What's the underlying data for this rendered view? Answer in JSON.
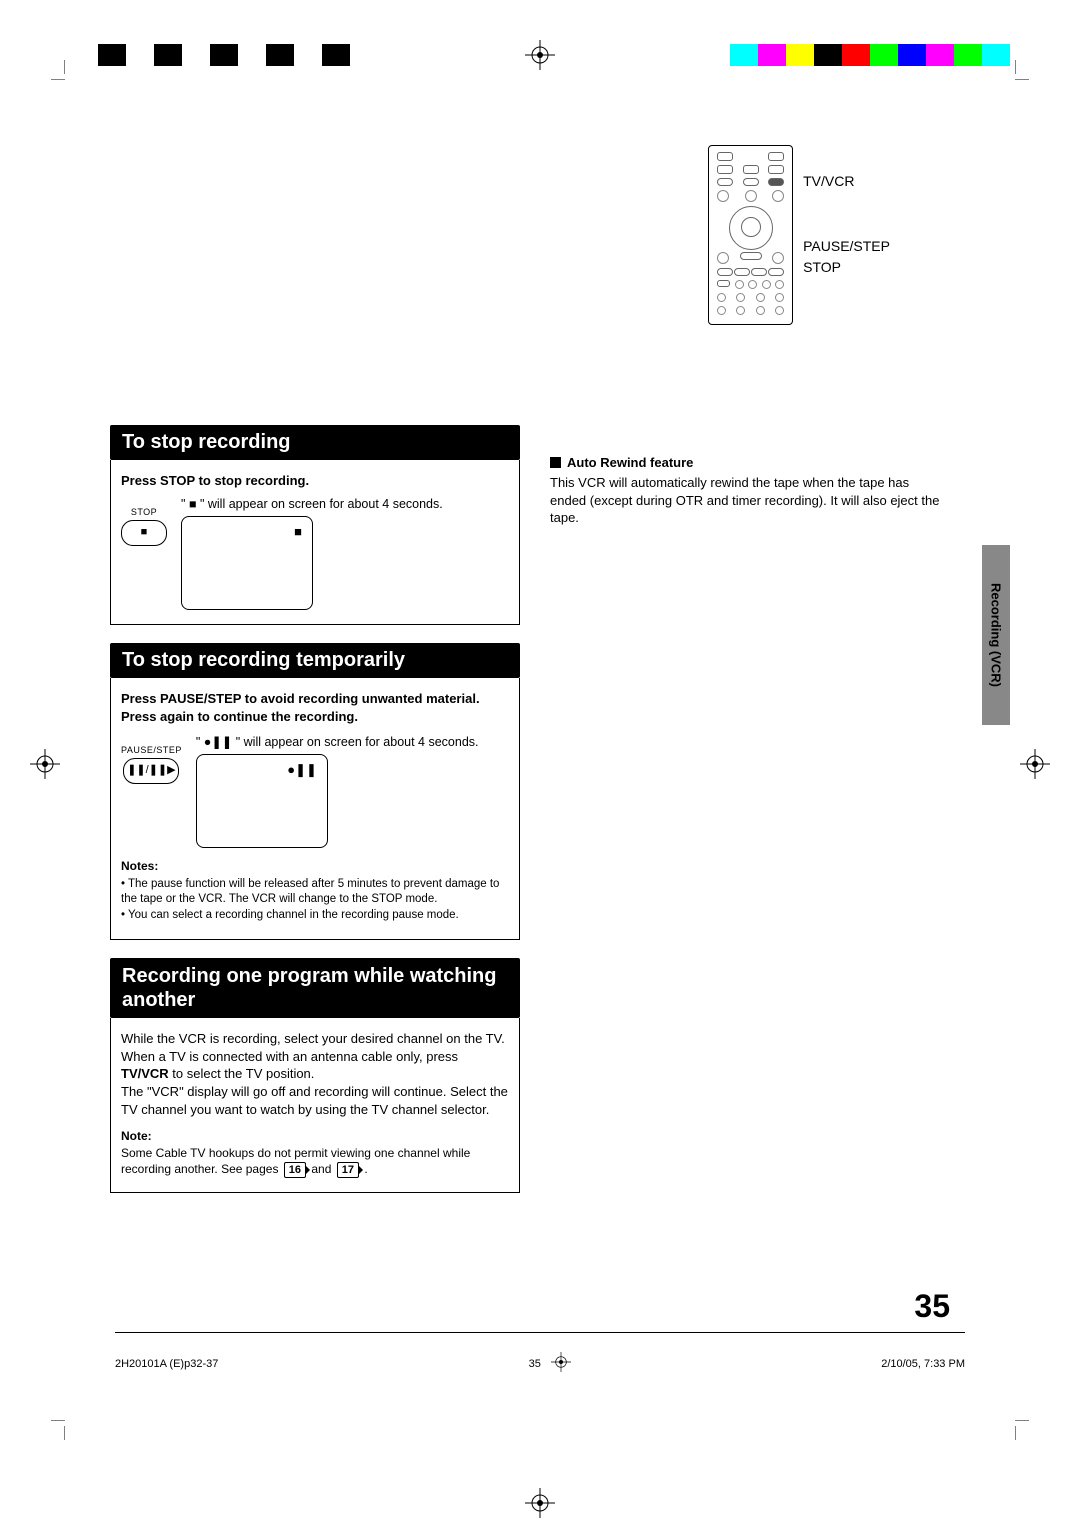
{
  "remote_labels": {
    "tvvcr": "TV/VCR",
    "pausestep": "PAUSE/STEP",
    "stop": "STOP"
  },
  "section1": {
    "header": "To stop recording",
    "instruction": "Press STOP to stop recording.",
    "btn_label": "STOP",
    "caption_pre": "\" ",
    "caption_post": " \" will appear on screen for about 4 seconds.",
    "screen_symbol": "■"
  },
  "section2": {
    "header": "To stop recording temporarily",
    "instruction": "Press PAUSE/STEP to avoid recording unwanted material. Press again to continue the recording.",
    "btn_label": "PAUSE/STEP",
    "caption": "\" ●❚❚ \" will appear on screen for about 4 seconds.",
    "screen_symbol": "●❚❚",
    "notes_head": "Notes:",
    "note1": "The pause function will be released after 5 minutes to prevent damage to the tape or the VCR. The VCR will change to the STOP mode.",
    "note2": "You can select a recording channel in the recording pause mode."
  },
  "section3": {
    "header": "Recording one program while watching another",
    "body_l1": "While the VCR is recording, select your desired channel on the TV.",
    "body_l2a": "When a TV is connected with an antenna cable only, press ",
    "body_l2b": "TV/VCR",
    "body_l2c": " to select the TV position.",
    "body_l3": "The \"VCR\" display  will go off and recording will continue. Select the TV channel you want to watch by using the TV channel selector.",
    "note_head": "Note:",
    "note_text_pre": "Some Cable TV hookups do not permit viewing one channel while recording another. See pages ",
    "page_ref1": "16",
    "note_text_mid": " and ",
    "page_ref2": "17",
    "note_text_post": " ."
  },
  "right_feature": {
    "head": "Auto Rewind feature",
    "body": "This VCR will automatically rewind the tape when the tape has ended (except during OTR and timer recording). It will also eject the tape."
  },
  "side_tab": "Recording (VCR)",
  "page_number": "35",
  "footer": {
    "left": "2H20101A (E)p32-37",
    "center": "35",
    "right": "2/10/05, 7:33 PM"
  }
}
